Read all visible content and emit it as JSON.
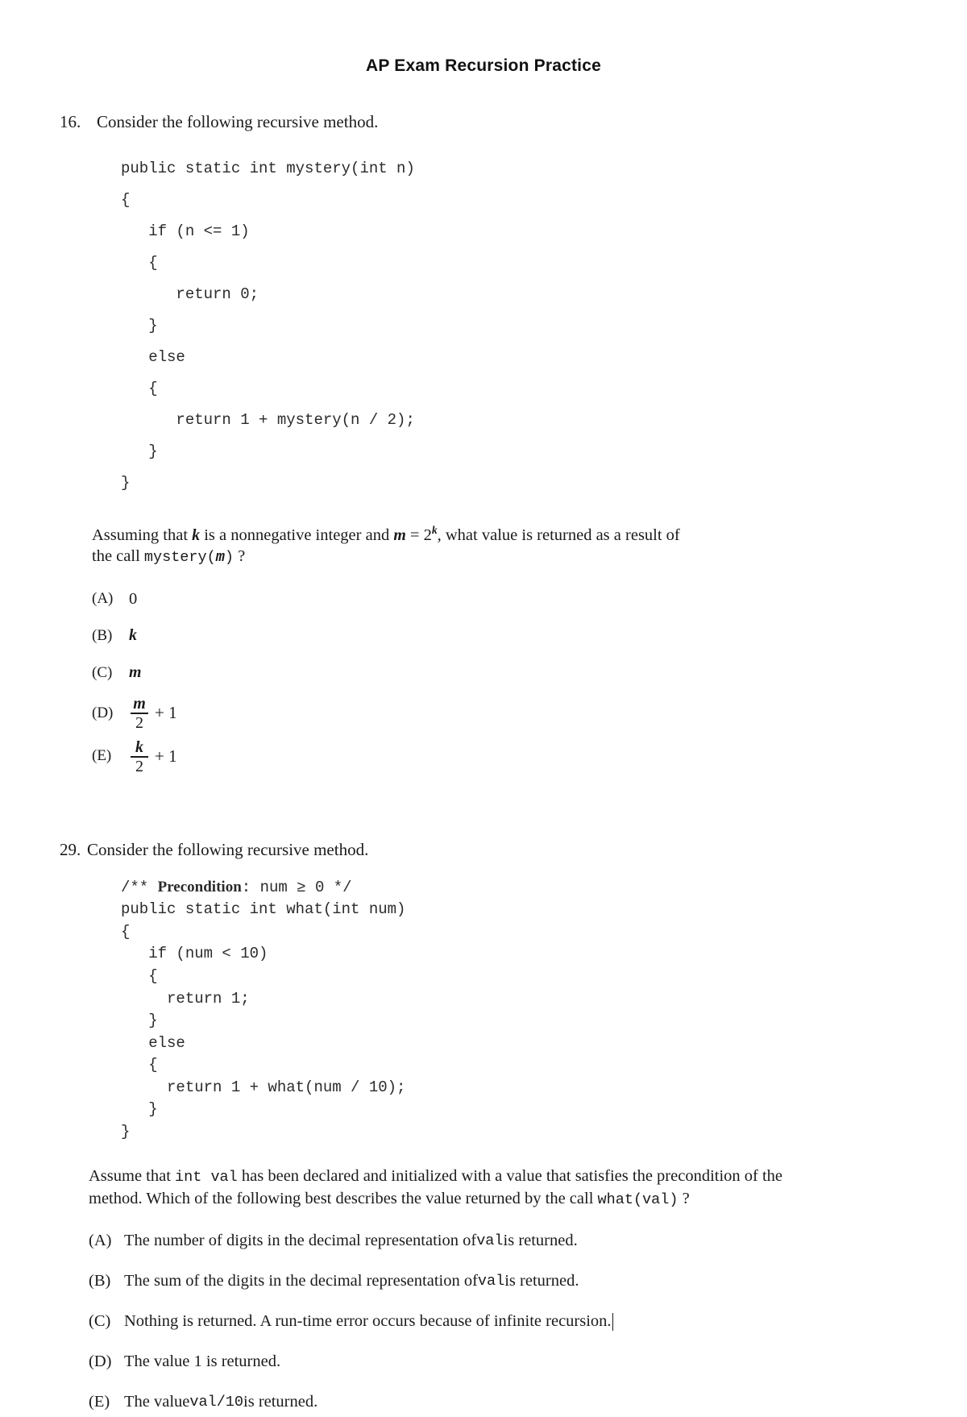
{
  "document": {
    "title": "AP Exam Recursion Practice"
  },
  "questions": [
    {
      "number": "16.",
      "stem": "Consider the following recursive method.",
      "code": "public static int mystery(int n)\n{\n   if (n <= 1)\n   {\n      return 0;\n   }\n   else\n   {\n      return 1 + mystery(n / 2);\n   }\n}",
      "prose_part1": "Assuming that ",
      "prose_k": "k",
      "prose_part2": " is a nonnegative integer and ",
      "prose_m": "m",
      "prose_eq": " = 2",
      "prose_exp": "k",
      "prose_part3": ", what value is returned as a result of the call ",
      "prose_call": "mystery(",
      "prose_call_arg": "m",
      "prose_call_end": ")",
      "prose_q": "?",
      "choices": [
        {
          "label": "(A)",
          "text": "0"
        },
        {
          "label": "(B)",
          "text": "k",
          "italic": true
        },
        {
          "label": "(C)",
          "text": "m",
          "italic": true
        },
        {
          "label": "(D)",
          "fraction": {
            "numerator": "m",
            "denominator": "2"
          },
          "suffix": "+ 1"
        },
        {
          "label": "(E)",
          "fraction": {
            "numerator": "k",
            "denominator": "2"
          },
          "suffix": "+ 1"
        }
      ]
    },
    {
      "number": "29.",
      "stem": "Consider the following recursive method.",
      "comment_open": "/** ",
      "comment_bold": "Precondition",
      "comment_rest": ": num ≥ 0 */",
      "code": "public static int what(int num)\n{\n   if (num < 10)\n   {\n     return 1;\n   }\n   else\n   {\n     return 1 + what(num / 10);\n   }\n}",
      "prose_part1": "Assume that ",
      "prose_mono1": "int val",
      "prose_part2": " has been declared and initialized with a value that satisfies the precondition of the method. Which of the following best describes the value returned by the call ",
      "prose_mono2": "what(val)",
      "prose_q": "?",
      "choices": [
        {
          "label": "(A)",
          "pre": "The number of digits in the decimal representation of ",
          "mono": "val",
          "post": " is returned."
        },
        {
          "label": "(B)",
          "pre": "The sum of the digits in the decimal representation of ",
          "mono": "val",
          "post": " is returned."
        },
        {
          "label": "(C)",
          "pre": "Nothing is returned. A run-time error occurs because of infinite recursion.",
          "mono": "",
          "post": "",
          "caret": true
        },
        {
          "label": "(D)",
          "pre": "The value 1 is returned.",
          "mono": "",
          "post": ""
        },
        {
          "label": "(E)",
          "pre": "The value ",
          "mono": "val/10",
          "post": " is returned."
        }
      ]
    }
  ]
}
